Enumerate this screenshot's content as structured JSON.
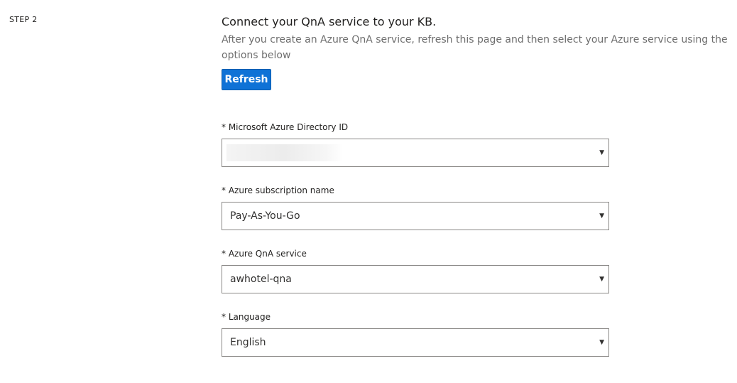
{
  "step": {
    "label": "STEP 2"
  },
  "header": {
    "title": "Connect your QnA service to your KB.",
    "description": "After you create an Azure QnA service, refresh this page and then select your Azure service using the options below"
  },
  "actions": {
    "refresh_label": "Refresh"
  },
  "fields": {
    "directory": {
      "label": "* Microsoft Azure Directory ID",
      "value": ""
    },
    "subscription": {
      "label": "* Azure subscription name",
      "value": "Pay-As-You-Go"
    },
    "service": {
      "label": "* Azure QnA service",
      "value": "awhotel-qna"
    },
    "language": {
      "label": "* Language",
      "value": "English"
    }
  },
  "icons": {
    "dropdown": "chevron-down-icon"
  },
  "colors": {
    "accent": "#0f72d6",
    "border": "#8a8886",
    "muted_text": "#6e6e6e"
  }
}
